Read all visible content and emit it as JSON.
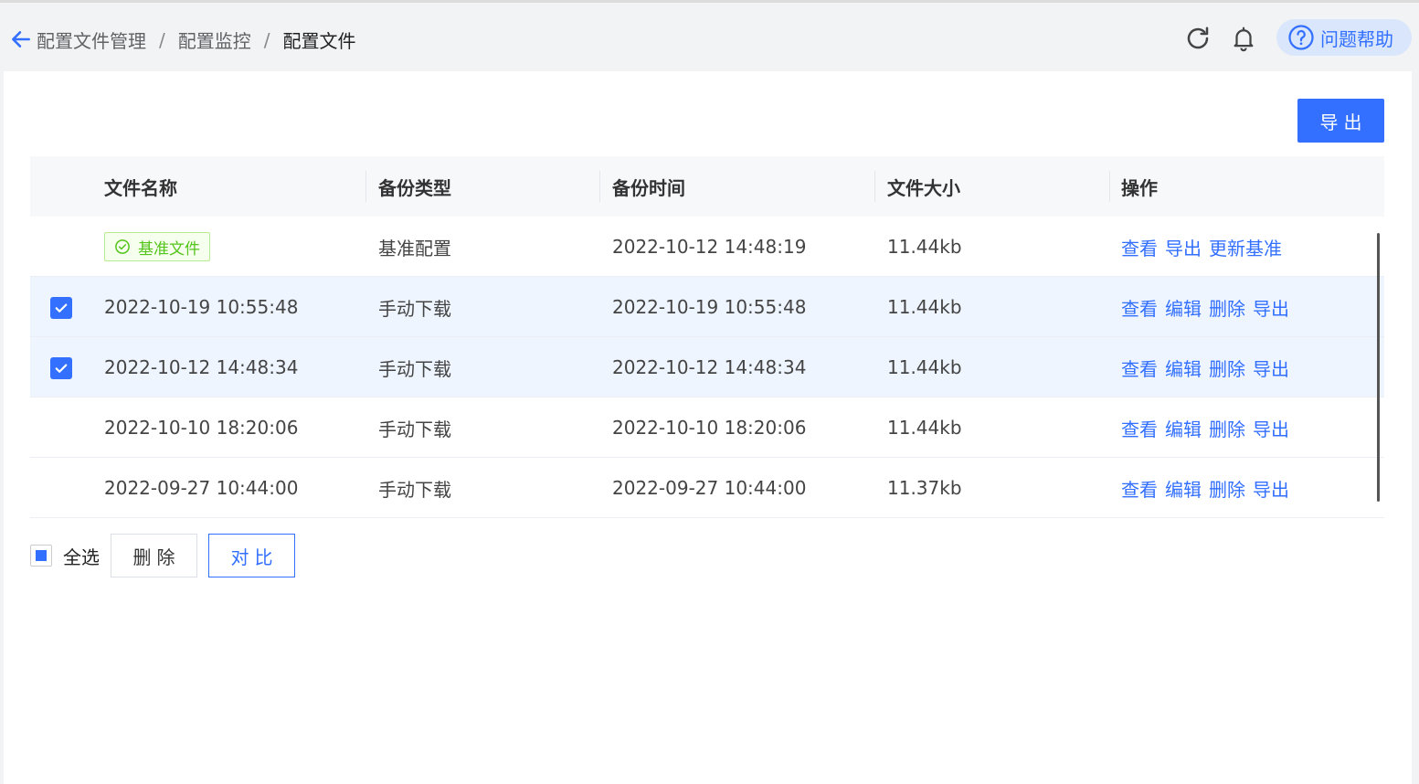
{
  "breadcrumb": [
    "配置文件管理",
    "配置监控",
    "配置文件"
  ],
  "breadcrumb_sep": "/",
  "header": {
    "help_label": "问题帮助"
  },
  "toolbar": {
    "export_label": "导出"
  },
  "columns": [
    "文件名称",
    "备份类型",
    "备份时间",
    "文件大小",
    "操作"
  ],
  "rows": [
    {
      "name": "基准文件",
      "is_baseline": true,
      "checked": false,
      "type": "基准配置",
      "time": "2022-10-12 14:48:19",
      "size": "11.44kb",
      "ops": [
        "查看",
        "导出",
        "更新基准"
      ]
    },
    {
      "name": "2022-10-19 10:55:48",
      "is_baseline": false,
      "checked": true,
      "type": "手动下载",
      "time": "2022-10-19 10:55:48",
      "size": "11.44kb",
      "ops": [
        "查看",
        "编辑",
        "删除",
        "导出"
      ]
    },
    {
      "name": "2022-10-12 14:48:34",
      "is_baseline": false,
      "checked": true,
      "type": "手动下载",
      "time": "2022-10-12 14:48:34",
      "size": "11.44kb",
      "ops": [
        "查看",
        "编辑",
        "删除",
        "导出"
      ]
    },
    {
      "name": "2022-10-10 18:20:06",
      "is_baseline": false,
      "checked": false,
      "type": "手动下载",
      "time": "2022-10-10 18:20:06",
      "size": "11.44kb",
      "ops": [
        "查看",
        "编辑",
        "删除",
        "导出"
      ]
    },
    {
      "name": "2022-09-27 10:44:00",
      "is_baseline": false,
      "checked": false,
      "type": "手动下载",
      "time": "2022-09-27 10:44:00",
      "size": "11.37kb",
      "ops": [
        "查看",
        "编辑",
        "删除",
        "导出"
      ]
    }
  ],
  "footer": {
    "select_all_label": "全选",
    "delete_label": "删除",
    "compare_label": "对比"
  },
  "colors": {
    "accent": "#3370ff",
    "baseline_tag": "#52c41a",
    "selected_row": "#eef5ff"
  },
  "icons": {
    "back": "arrow-left-icon",
    "refresh": "refresh-icon",
    "bell": "bell-icon",
    "help": "question-circle-icon",
    "check": "check-icon",
    "baseline": "check-circle-icon"
  }
}
